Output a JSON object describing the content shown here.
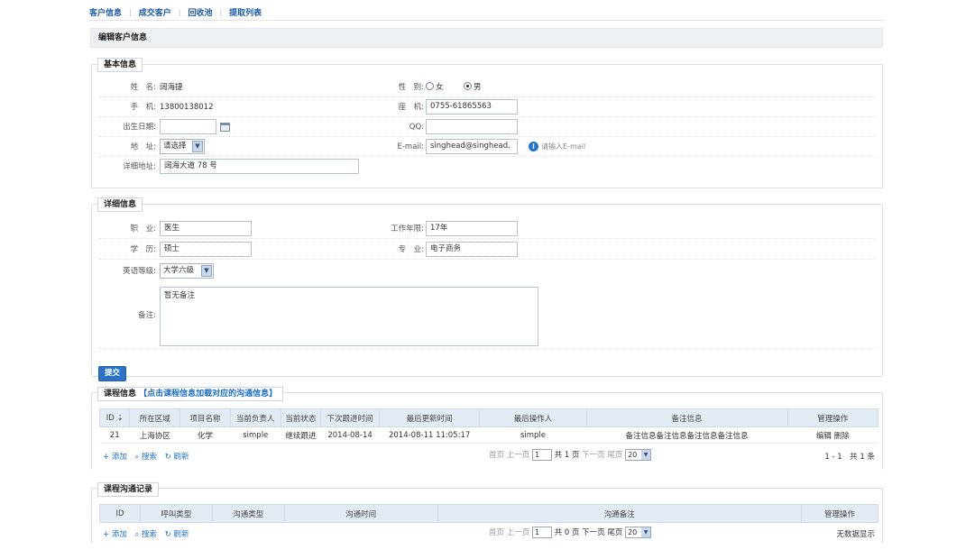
{
  "nav": {
    "items": [
      "客户信息",
      "成交客户",
      "回收池",
      "提取列表"
    ]
  },
  "page_title": "编辑客户信息",
  "basic": {
    "legend": "基本信息",
    "name_label": "姓　名:",
    "name_value": "阔海捷",
    "gender_label": "性　别:",
    "gender_female": "女",
    "gender_male": "男",
    "mobile_label": "手　机:",
    "mobile_value": "13800138012",
    "phone_label": "座　机:",
    "phone_value": "0755-61865563",
    "birth_label": "出生日期:",
    "birth_value": "",
    "qq_label": "QQ:",
    "qq_value": "",
    "addr_label": "地　址:",
    "addr_select": "请选择",
    "email_label": "E-mail:",
    "email_value": "singhead@singhead.",
    "email_hint": "请输入E-mail",
    "detail_addr_label": "详细地址:",
    "detail_addr_value": "阔海大道 78 号"
  },
  "detail": {
    "legend": "详细信息",
    "job_label": "职　业:",
    "job_value": "医生",
    "years_label": "工作年限:",
    "years_value": "17年",
    "edu_label": "学　历:",
    "edu_value": "硕士",
    "major_label": "专　业:",
    "major_value": "电子商务",
    "english_label": "英语等级:",
    "english_select": "大学六级",
    "remark_label": "备注:",
    "remark_value": "暂无备注",
    "submit_label": "提交"
  },
  "courses": {
    "legend": "课程信息",
    "legend_link": "【点击课程信息加载对应的沟通信息】",
    "headers": [
      "ID ⇣",
      "所在区域",
      "项目名称",
      "当前负责人",
      "当前状态",
      "下次跟进时间",
      "最后更新时间",
      "最后操作人",
      "备注信息",
      "管理操作"
    ],
    "rows": [
      [
        "21",
        "上海协区",
        "化学",
        "simple",
        "继续跟进",
        "2014-08-14",
        "2014-08-11 11:05:17",
        "simple",
        "备注信息备注信息备注信息备注信息",
        "编辑 删除"
      ]
    ],
    "footer": {
      "add": "+ 添加",
      "search": "⌕ 搜索",
      "refresh": "↻ 刷新",
      "first": "首页",
      "prev": "上一页",
      "page": "1",
      "total": "共 1 页",
      "next": "下一页",
      "last": "尾页",
      "size": "20",
      "summary": "1 - 1　共 1 条"
    }
  },
  "comms": {
    "legend": "课程沟通记录",
    "headers": [
      "ID",
      "呼叫类型",
      "沟通类型",
      "沟通时间",
      "沟通备注",
      "管理操作"
    ],
    "footer": {
      "add": "+ 添加",
      "search": "⌕ 搜索",
      "refresh": "↻ 刷新",
      "first": "首页",
      "prev": "上一页",
      "page": "1",
      "total": "共 0 页",
      "next": "下一页",
      "last": "尾页",
      "size": "20",
      "summary": "无数据显示"
    }
  }
}
